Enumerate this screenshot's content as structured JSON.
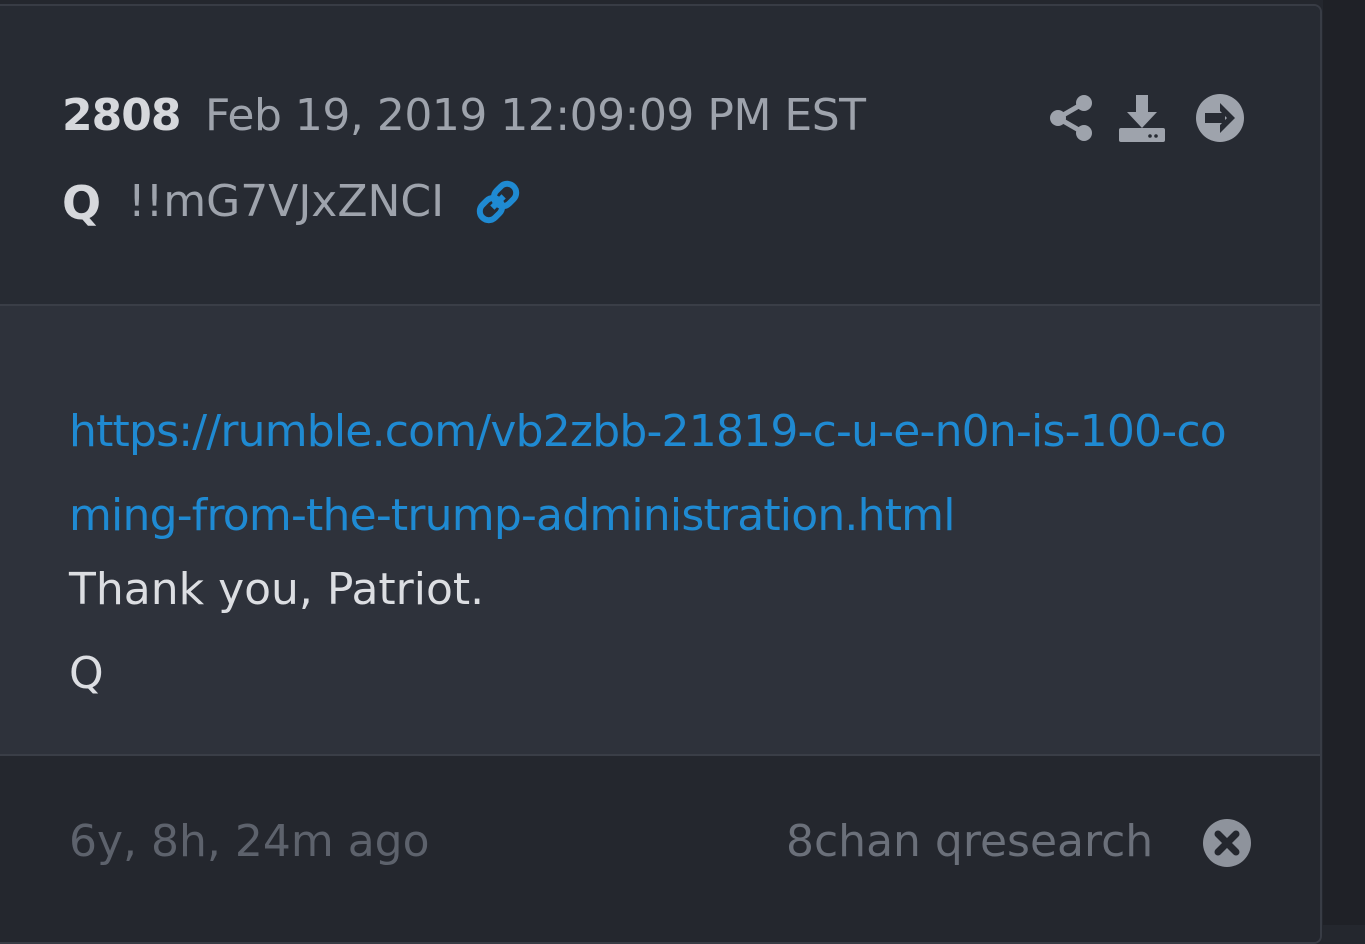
{
  "post": {
    "number": "2808",
    "date": "Feb 19, 2019 12:09:09 PM EST",
    "author": "Q",
    "tripcode": "!!mG7VJxZNCI"
  },
  "actions": {
    "share_icon": "share-icon",
    "download_icon": "download-icon",
    "open_icon": "arrow-circle-right-icon",
    "tripcode_link_icon": "link-icon"
  },
  "body": {
    "link": "https://rumble.com/vb2zbb-21819-c-u-e-n0n-is-100-coming-from-the-trump-administration.html",
    "line1": "Thank you, Patriot.",
    "line2": "Q"
  },
  "footer": {
    "time_ago": "6y, 8h, 24m ago",
    "source": "8chan qresearch",
    "close_icon": "close-circle-icon"
  },
  "colors": {
    "background": "#24272e",
    "card": "#272b33",
    "body_bg": "#2e323b",
    "link": "#1f8ad2",
    "icon": "#9ea3ac"
  }
}
